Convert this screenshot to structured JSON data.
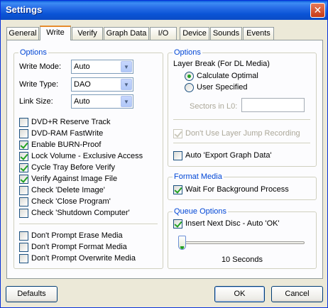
{
  "window": {
    "title": "Settings",
    "close_glyph": "✕"
  },
  "tabs": [
    {
      "label": "General"
    },
    {
      "label": "Write"
    },
    {
      "label": "Verify"
    },
    {
      "label": "Graph Data"
    },
    {
      "label": "I/O"
    },
    {
      "label": "Device"
    },
    {
      "label": "Sounds"
    },
    {
      "label": "Events"
    }
  ],
  "active_tab": "Write",
  "left_options": {
    "legend": "Options",
    "write_mode": {
      "label": "Write Mode:",
      "value": "Auto"
    },
    "write_type": {
      "label": "Write Type:",
      "value": "DAO"
    },
    "link_size": {
      "label": "Link Size:",
      "value": "Auto"
    },
    "checks_a": [
      {
        "label": "DVD+R Reserve Track",
        "checked": false
      },
      {
        "label": "DVD-RAM FastWrite",
        "checked": false
      },
      {
        "label": "Enable BURN-Proof",
        "checked": true
      },
      {
        "label": "Lock Volume - Exclusive Access",
        "checked": true
      },
      {
        "label": "Cycle Tray Before Verify",
        "checked": true
      },
      {
        "label": "Verify Against Image File",
        "checked": true
      },
      {
        "label": "Check 'Delete Image'",
        "checked": false
      },
      {
        "label": "Check 'Close Program'",
        "checked": false
      },
      {
        "label": "Check 'Shutdown Computer'",
        "checked": false
      }
    ],
    "checks_b": [
      {
        "label": "Don't Prompt Erase Media",
        "checked": false
      },
      {
        "label": "Don't Prompt Format Media",
        "checked": false
      },
      {
        "label": "Don't Prompt Overwrite Media",
        "checked": false
      }
    ]
  },
  "right_options": {
    "legend": "Options",
    "layer_break_label": "Layer Break (For DL Media)",
    "radio_calculate": "Calculate Optimal",
    "radio_user": "User Specified",
    "radio_selected": "Calculate Optimal",
    "sectors_label": "Sectors in L0:",
    "sectors_value": "",
    "layer_jump": {
      "label": "Don't Use Layer Jump Recording",
      "checked": true,
      "disabled": true
    },
    "auto_export": {
      "label": "Auto 'Export Graph Data'",
      "checked": false
    }
  },
  "format_media": {
    "legend": "Format Media",
    "wait": {
      "label": "Wait For Background Process",
      "checked": true
    }
  },
  "queue_options": {
    "legend": "Queue Options",
    "insert_next": {
      "label": "Insert Next Disc - Auto 'OK'",
      "checked": true
    },
    "slider_fraction": 0.0,
    "slider_value": "10 Seconds"
  },
  "buttons": {
    "defaults": "Defaults",
    "ok": "OK",
    "cancel": "Cancel"
  },
  "icons": {
    "dropdown": "chevron-down-icon",
    "close": "close-icon"
  }
}
